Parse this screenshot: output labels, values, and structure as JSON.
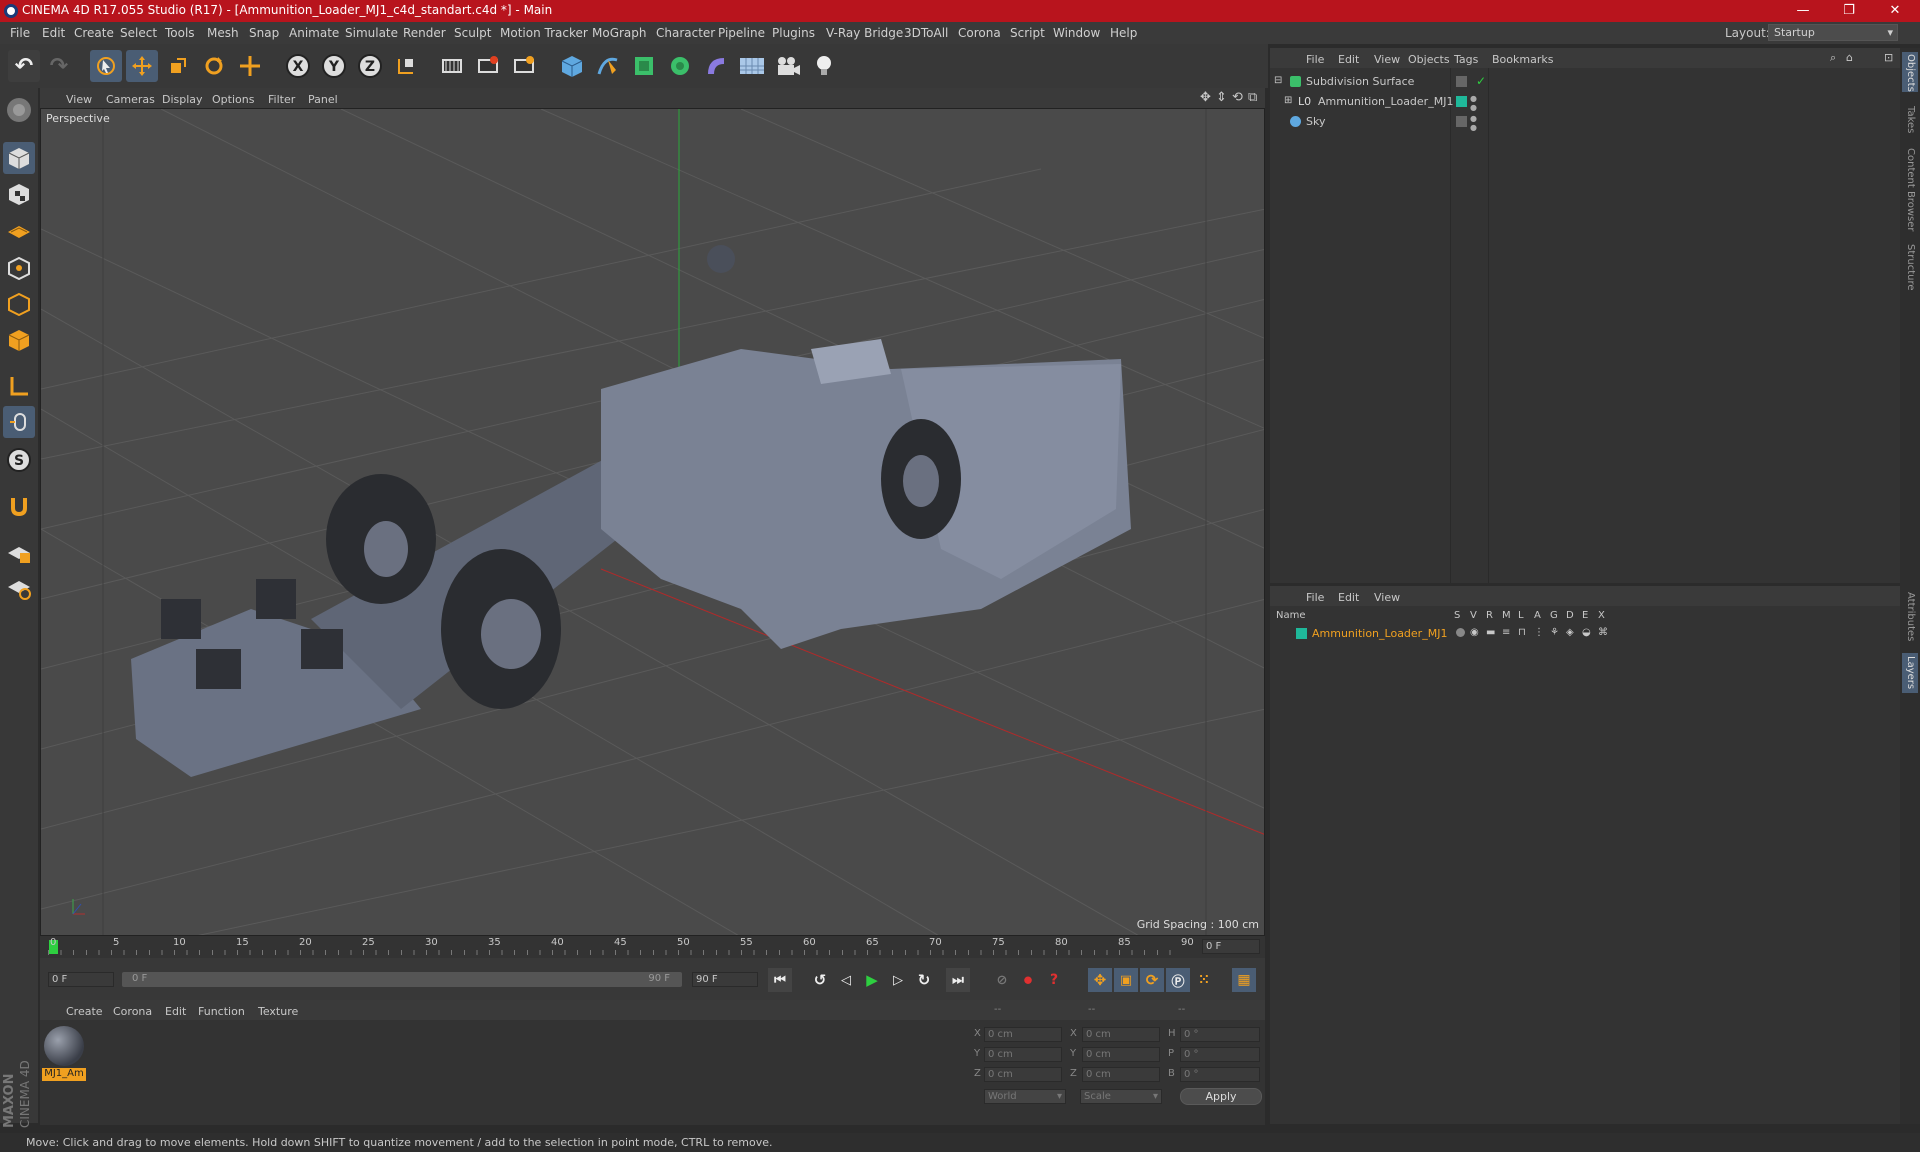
{
  "window": {
    "title": "CINEMA 4D R17.055 Studio (R17) - [Ammunition_Loader_MJ1_c4d_standart.c4d *] - Main"
  },
  "menu": [
    "File",
    "Edit",
    "Create",
    "Select",
    "Tools",
    "Mesh",
    "Snap",
    "Animate",
    "Simulate",
    "Render",
    "Sculpt",
    "Motion Tracker",
    "MoGraph",
    "Character",
    "Pipeline",
    "Plugins",
    "V-Ray Bridge",
    "3DToAll",
    "Corona",
    "Script",
    "Window",
    "Help"
  ],
  "layout": {
    "label": "Layout:",
    "value": "Startup"
  },
  "viewport": {
    "menu": [
      "View",
      "Cameras",
      "Display",
      "Options",
      "Filter",
      "Panel"
    ],
    "label": "Perspective",
    "grid_spacing": "Grid Spacing : 100 cm"
  },
  "timeline": {
    "ticks": [
      "0",
      "5",
      "10",
      "15",
      "20",
      "25",
      "30",
      "35",
      "40",
      "45",
      "50",
      "55",
      "60",
      "65",
      "70",
      "75",
      "80",
      "85",
      "90"
    ],
    "frame_field": "0 F",
    "start": "0 F",
    "range_start": "0 F",
    "range_end": "90 F",
    "end": "90 F"
  },
  "material_panel": {
    "menu": [
      "Create",
      "Corona",
      "Edit",
      "Function",
      "Texture"
    ],
    "material_name": "MJ1_Am"
  },
  "coord_panel": {
    "headers": [
      "--",
      "--",
      "--"
    ],
    "rows": [
      {
        "a": "X",
        "av": "0 cm",
        "b": "X",
        "bv": "0 cm",
        "c": "H",
        "cv": "0 °"
      },
      {
        "a": "Y",
        "av": "0 cm",
        "b": "Y",
        "bv": "0 cm",
        "c": "P",
        "cv": "0 °"
      },
      {
        "a": "Z",
        "av": "0 cm",
        "b": "Z",
        "bv": "0 cm",
        "c": "B",
        "cv": "0 °"
      }
    ],
    "world": "World",
    "scale": "Scale",
    "apply": "Apply"
  },
  "object_manager": {
    "menu": [
      "File",
      "Edit",
      "View",
      "Objects",
      "Tags",
      "Bookmarks"
    ],
    "objects": [
      "Subdivision Surface",
      "Ammunition_Loader_MJ1",
      "Sky"
    ]
  },
  "layer_manager": {
    "menu": [
      "File",
      "Edit",
      "View"
    ],
    "columns": [
      "Name",
      "S",
      "V",
      "R",
      "M",
      "L",
      "A",
      "G",
      "D",
      "E",
      "X"
    ],
    "layers": [
      "Ammunition_Loader_MJ1"
    ]
  },
  "side_tabs": [
    "Objects",
    "Takes",
    "Content Browser",
    "Structure",
    "Attributes",
    "Layers"
  ],
  "brand": [
    "MAXON",
    "CINEMA 4D"
  ],
  "status": "Move: Click and drag to move elements. Hold down SHIFT to quantize movement / add to the selection in point mode, CTRL to remove.",
  "colors": {
    "title_bar": "#b8141d",
    "accent_orange": "#f0a020",
    "layer_teal": "#1fb89a",
    "select_blue": "#4a5d74"
  }
}
